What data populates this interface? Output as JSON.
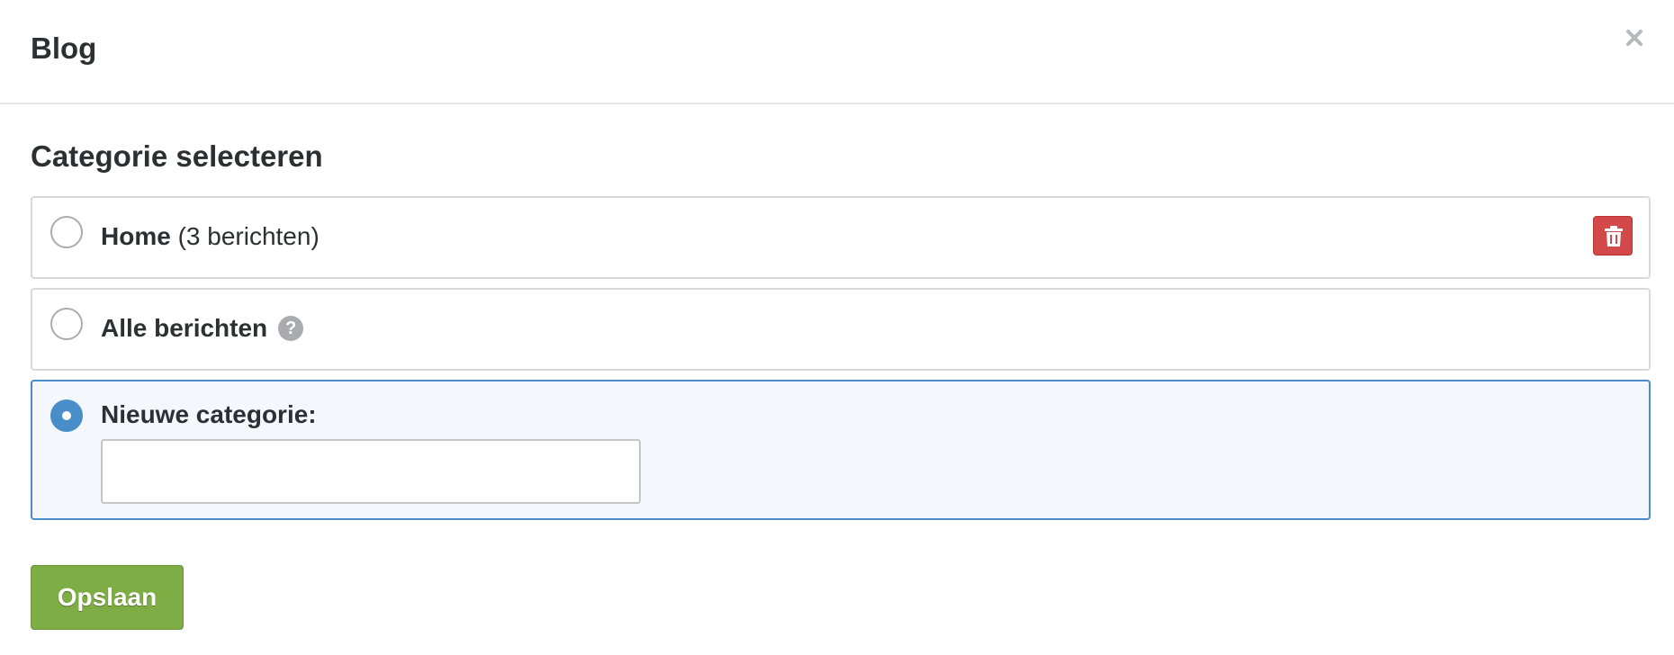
{
  "modal": {
    "title": "Blog",
    "close_icon": "close-icon"
  },
  "body": {
    "section_title": "Categorie selecteren",
    "options": [
      {
        "name": "Home",
        "count": "(3 berichten)",
        "selected": false,
        "has_delete": true,
        "delete_icon": "trash-icon"
      },
      {
        "name": "Alle berichten",
        "selected": false,
        "help_icon": "question-circle-icon",
        "help_glyph": "?"
      },
      {
        "name": "Nieuwe categorie:",
        "selected": true,
        "input_value": "",
        "input_placeholder": ""
      }
    ],
    "save_label": "Opslaan"
  },
  "colors": {
    "save_green": "#7fad45",
    "delete_red": "#d34848",
    "selected_blue": "#4a8ec9",
    "selected_bg": "#f4f8fc"
  }
}
